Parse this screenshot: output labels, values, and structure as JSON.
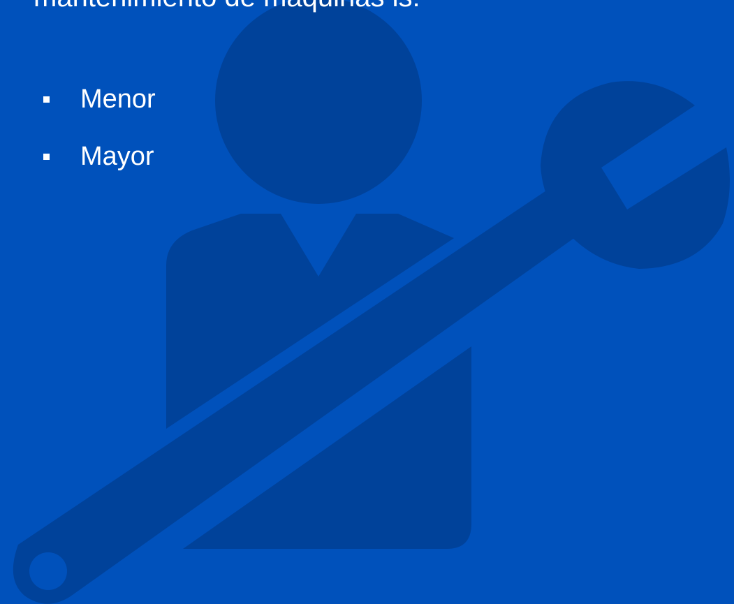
{
  "slide": {
    "heading_partial": "mantenimiento de máquinas is:",
    "bullets": [
      {
        "label": "Menor"
      },
      {
        "label": "Mayor"
      }
    ]
  },
  "illustration": {
    "icon": "technician-with-wrench-icon"
  },
  "colors": {
    "background": "#0051bb",
    "silhouette": "#00439a",
    "text": "#ffffff"
  }
}
